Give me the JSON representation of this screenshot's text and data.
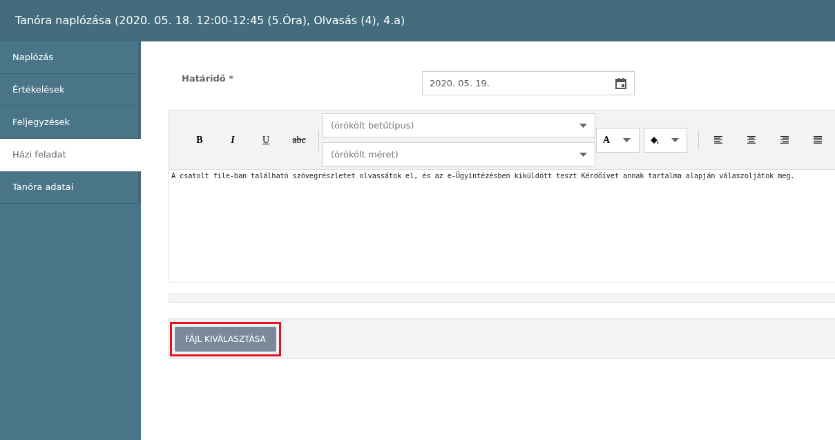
{
  "window": {
    "title": "Tanóra naplózása (2020. 05. 18. 12:00-12:45 (5.Óra), Olvasás (4), 4.a)"
  },
  "sidebar": {
    "items": [
      {
        "label": "Naplózás",
        "selected": false
      },
      {
        "label": "Értékelések",
        "selected": false
      },
      {
        "label": "Feljegyzések",
        "selected": false
      },
      {
        "label": "Házi feladat",
        "selected": true
      },
      {
        "label": "Tanóra adatai",
        "selected": false
      }
    ]
  },
  "deadline": {
    "label": "Határidő *",
    "value": "2020. 05. 19."
  },
  "editor": {
    "format_buttons": [
      "B",
      "I",
      "U",
      "abc"
    ],
    "font_select": {
      "placeholder": "(örökölt betűtípus)"
    },
    "size_select": {
      "placeholder": "(örökölt méret)"
    },
    "text_color_button": "A",
    "text": "A csatolt file-ban található szövegrészletet olvassátok el, és az e-Ügyintézésben kiküldött teszt Kérdőívet annak tartalma alapján válaszoljátok meg."
  },
  "file_button": {
    "label": "FÁJL KIVÁLASZTÁSA",
    "highlighted": true
  }
}
